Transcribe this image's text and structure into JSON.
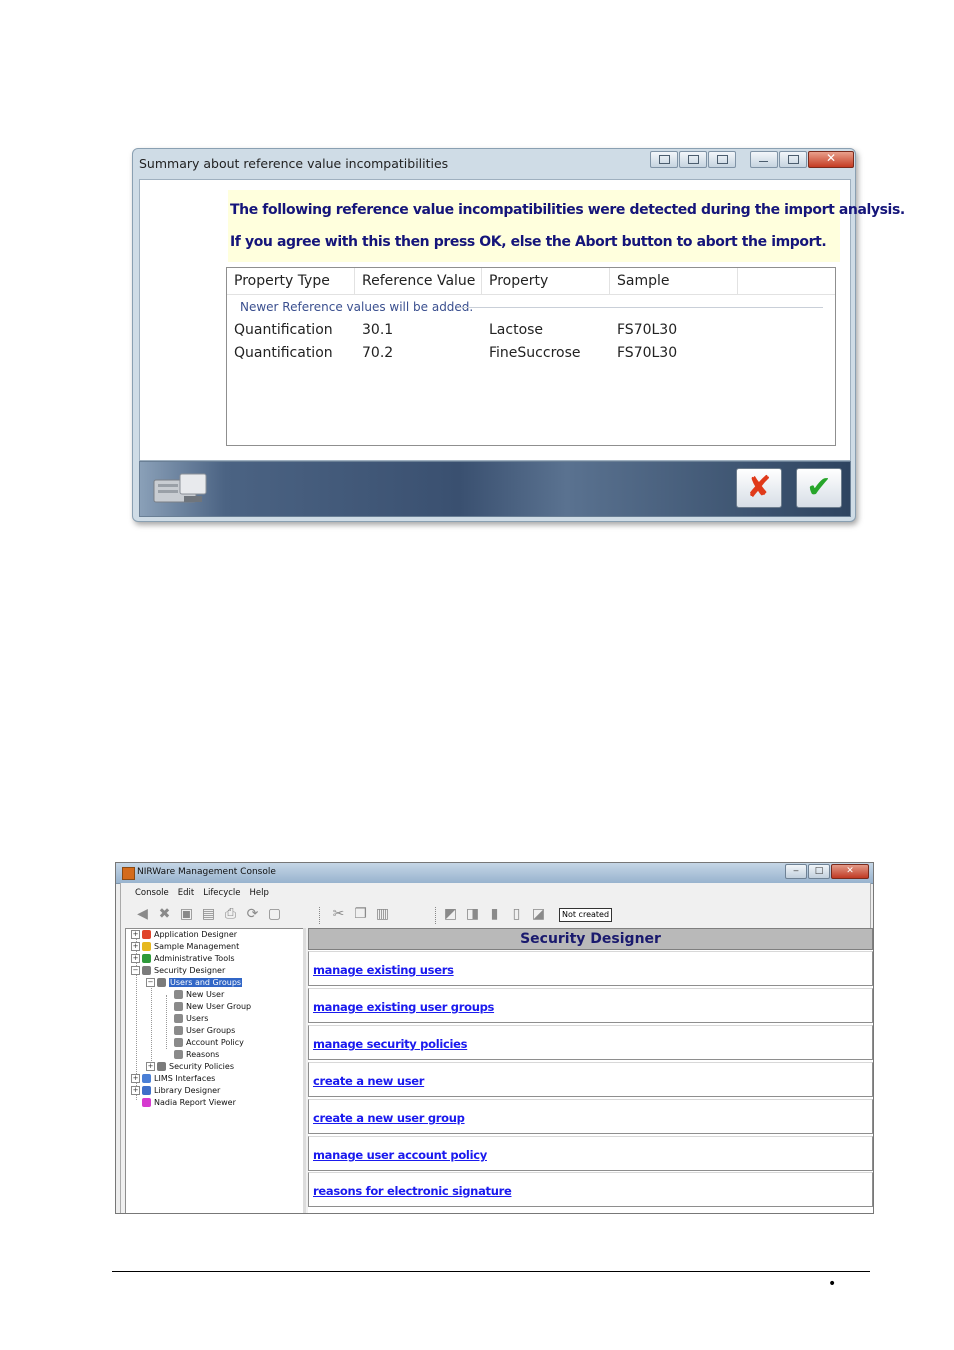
{
  "dialog": {
    "title": "Summary about reference value incompatibilities",
    "message_line1": "The following reference value incompatibilities were detected during the import analysis.",
    "message_line2": "If you agree with this then press OK, else the Abort button to abort the import.",
    "columns": [
      "Property Type",
      "Reference Value",
      "Property",
      "Sample"
    ],
    "group_label": "Newer Reference values will be added.",
    "rows": [
      {
        "type": "Quantification",
        "value": "30.1",
        "property": "Lactose",
        "sample": "FS70L30"
      },
      {
        "type": "Quantification",
        "value": "70.2",
        "property": "FineSuccrose",
        "sample": "FS70L30"
      }
    ],
    "abort_glyph": "✘",
    "ok_glyph": "✔"
  },
  "console": {
    "title": "NIRWare Management Console",
    "menu": [
      "Console",
      "Edit",
      "Lifecycle",
      "Help"
    ],
    "status_box": "Not created",
    "tree": {
      "application_designer": "Application Designer",
      "sample_management": "Sample Management",
      "administrative_tools": "Administrative Tools",
      "security_designer": "Security Designer",
      "users_and_groups": "Users and Groups",
      "new_user": "New User",
      "new_user_group": "New User Group",
      "users": "Users",
      "user_groups": "User Groups",
      "account_policy": "Account Policy",
      "reasons": "Reasons",
      "security_policies": "Security Policies",
      "lims_interfaces": "LIMS Interfaces",
      "library_designer": "Library Designer",
      "nadia_report_viewer": "Nadia Report Viewer"
    },
    "pane_title": "Security Designer",
    "links": [
      "manage existing users",
      "manage existing user groups",
      "manage security policies",
      "create a new user",
      "create a new user group",
      "manage user account policy",
      "reasons for electronic signature"
    ]
  },
  "colors": {
    "message_text": "#15157a",
    "link": "#1a1aee",
    "tree_selection": "#3166c6"
  },
  "footer": {
    "bullet": "•"
  }
}
